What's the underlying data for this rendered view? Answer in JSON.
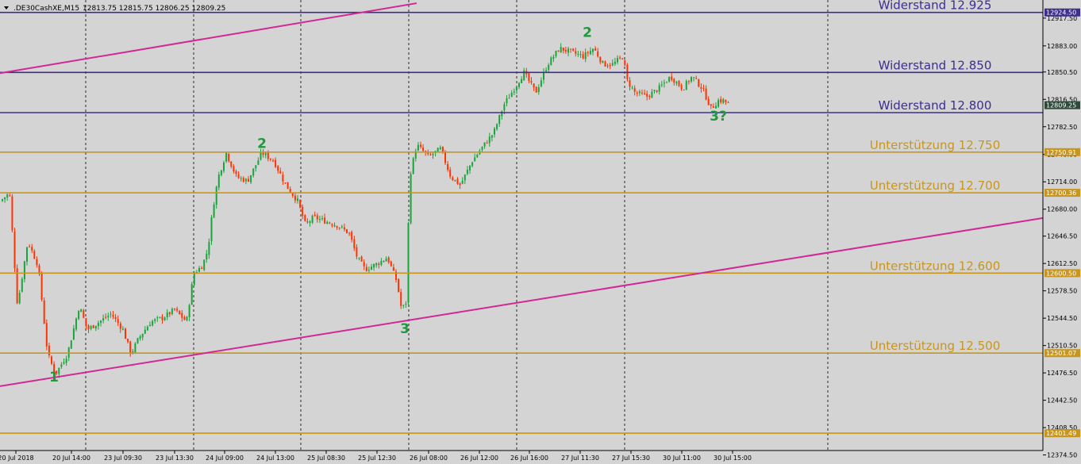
{
  "header": {
    "symbol_label": ".DE30CashXE,M15",
    "ohlc_label": "12813.75 12815.75 12806.25 12809.25"
  },
  "colors": {
    "background": "#d4d4d4",
    "bull": "#1aa43c",
    "bear": "#ff3300",
    "resistance": "#3c2e8c",
    "support": "#c8961e",
    "trendline": "#d22896",
    "wave_label": "#1e9a3c"
  },
  "chart_data": {
    "type": "candlestick",
    "symbol": ".DE30CashXE",
    "timeframe": "M15",
    "ylim": [
      12380,
      12940
    ],
    "y_ticks": [
      12917.5,
      12883.0,
      12850.5,
      12816.5,
      12782.5,
      12748.0,
      12714.0,
      12680.0,
      12646.5,
      12612.5,
      12578.5,
      12544.5,
      12510.5,
      12476.5,
      12442.5,
      12408.5,
      12374.5
    ],
    "x_ticks": [
      "20 Jul 2018",
      "20 Jul 14:00",
      "23 Jul 09:30",
      "23 Jul 13:30",
      "24 Jul 09:00",
      "24 Jul 13:00",
      "25 Jul 08:30",
      "25 Jul 12:30",
      "26 Jul 08:00",
      "26 Jul 12:00",
      "26 Jul 16:00",
      "27 Jul 11:30",
      "27 Jul 15:30",
      "30 Jul 11:00",
      "30 Jul 15:00"
    ],
    "price_tags": [
      {
        "value": 12924.5,
        "kind": "resistance"
      },
      {
        "value": 12809.25,
        "kind": "current"
      },
      {
        "value": 12750.91,
        "kind": "support"
      },
      {
        "value": 12700.36,
        "kind": "support"
      },
      {
        "value": 12600.5,
        "kind": "support"
      },
      {
        "value": 12501.07,
        "kind": "support"
      },
      {
        "value": 12401.49,
        "kind": "support"
      }
    ],
    "levels": [
      {
        "kind": "resistance",
        "value": 12924.5,
        "label": "Widerstand 12.925"
      },
      {
        "kind": "resistance",
        "value": 12850.0,
        "label": "Widerstand 12.850"
      },
      {
        "kind": "resistance",
        "value": 12800.0,
        "label": "Widerstand  12.800"
      },
      {
        "kind": "support",
        "value": 12750.91,
        "label": "Unterstützung 12.750"
      },
      {
        "kind": "support",
        "value": 12700.36,
        "label": "Unterstützung 12.700"
      },
      {
        "kind": "support",
        "value": 12600.5,
        "label": "Unterstützung 12.600"
      },
      {
        "kind": "support",
        "value": 12501.07,
        "label": "Unterstützung 12.500"
      },
      {
        "kind": "support",
        "value": 12401.49,
        "label": ""
      }
    ],
    "path": [
      [
        0,
        12690
      ],
      [
        12,
        12700
      ],
      [
        22,
        12560
      ],
      [
        35,
        12640
      ],
      [
        48,
        12610
      ],
      [
        60,
        12500
      ],
      [
        70,
        12475
      ],
      [
        85,
        12500
      ],
      [
        100,
        12560
      ],
      [
        110,
        12530
      ],
      [
        125,
        12540
      ],
      [
        140,
        12550
      ],
      [
        155,
        12530
      ],
      [
        165,
        12500
      ],
      [
        175,
        12520
      ],
      [
        190,
        12540
      ],
      [
        205,
        12545
      ],
      [
        220,
        12555
      ],
      [
        235,
        12540
      ],
      [
        244,
        12600
      ],
      [
        255,
        12610
      ],
      [
        262,
        12630
      ],
      [
        268,
        12680
      ],
      [
        275,
        12720
      ],
      [
        285,
        12750
      ],
      [
        298,
        12720
      ],
      [
        312,
        12715
      ],
      [
        330,
        12750
      ],
      [
        345,
        12740
      ],
      [
        360,
        12710
      ],
      [
        375,
        12690
      ],
      [
        385,
        12660
      ],
      [
        395,
        12670
      ],
      [
        410,
        12665
      ],
      [
        425,
        12660
      ],
      [
        440,
        12650
      ],
      [
        450,
        12620
      ],
      [
        460,
        12605
      ],
      [
        475,
        12612
      ],
      [
        488,
        12620
      ],
      [
        500,
        12590
      ],
      [
        506,
        12555
      ],
      [
        512,
        12565
      ],
      [
        516,
        12720
      ],
      [
        525,
        12760
      ],
      [
        540,
        12745
      ],
      [
        555,
        12755
      ],
      [
        568,
        12720
      ],
      [
        580,
        12710
      ],
      [
        595,
        12740
      ],
      [
        610,
        12760
      ],
      [
        622,
        12775
      ],
      [
        635,
        12810
      ],
      [
        648,
        12830
      ],
      [
        660,
        12850
      ],
      [
        675,
        12825
      ],
      [
        690,
        12860
      ],
      [
        705,
        12880
      ],
      [
        720,
        12875
      ],
      [
        735,
        12870
      ],
      [
        748,
        12880
      ],
      [
        760,
        12860
      ],
      [
        772,
        12860
      ],
      [
        785,
        12870
      ],
      [
        790,
        12840
      ],
      [
        800,
        12825
      ],
      [
        815,
        12820
      ],
      [
        830,
        12830
      ],
      [
        845,
        12845
      ],
      [
        860,
        12830
      ],
      [
        872,
        12845
      ],
      [
        885,
        12830
      ],
      [
        896,
        12805
      ],
      [
        905,
        12815
      ],
      [
        912,
        12815
      ],
      [
        920,
        12809
      ]
    ],
    "trendlines": [
      {
        "from": [
          0,
          12849
        ],
        "to": [
          525,
          12936
        ]
      },
      {
        "from": [
          0,
          12460
        ],
        "to": [
          1314,
          12669
        ]
      }
    ],
    "wave_labels": [
      {
        "text": "1",
        "x": 68,
        "y": 12466
      },
      {
        "text": "2",
        "x": 330,
        "y": 12756
      },
      {
        "text": "3",
        "x": 510,
        "y": 12526
      },
      {
        "text": "2",
        "x": 740,
        "y": 12894
      },
      {
        "text": "3?",
        "x": 905,
        "y": 12790
      }
    ]
  }
}
